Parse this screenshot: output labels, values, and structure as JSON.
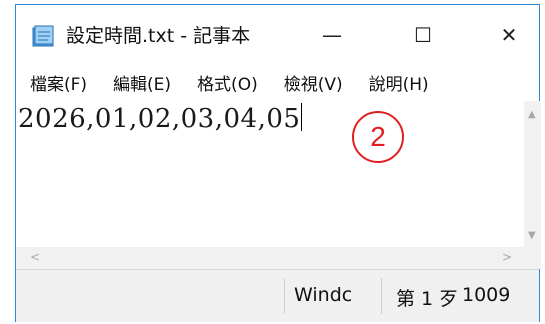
{
  "window": {
    "title": "設定時間.txt - 記事本",
    "minimize_symbol": "—",
    "maximize_symbol": "☐",
    "close_symbol": "✕",
    "icon": "notepad-icon"
  },
  "menu": {
    "items": [
      {
        "label": "檔案(F)"
      },
      {
        "label": "編輯(E)"
      },
      {
        "label": "格式(O)"
      },
      {
        "label": "檢視(V)"
      },
      {
        "label": "說明(H)"
      }
    ]
  },
  "editor": {
    "content": "2026,01,02,03,04,05"
  },
  "statusbar": {
    "encoding": "Windc",
    "position": "第 1 歹",
    "zoom": "1009"
  },
  "annotation": {
    "number": "2",
    "color": "#e02020"
  },
  "colors": {
    "window_border": "#2e8ad8",
    "statusbar_bg": "#f0f0f0"
  }
}
